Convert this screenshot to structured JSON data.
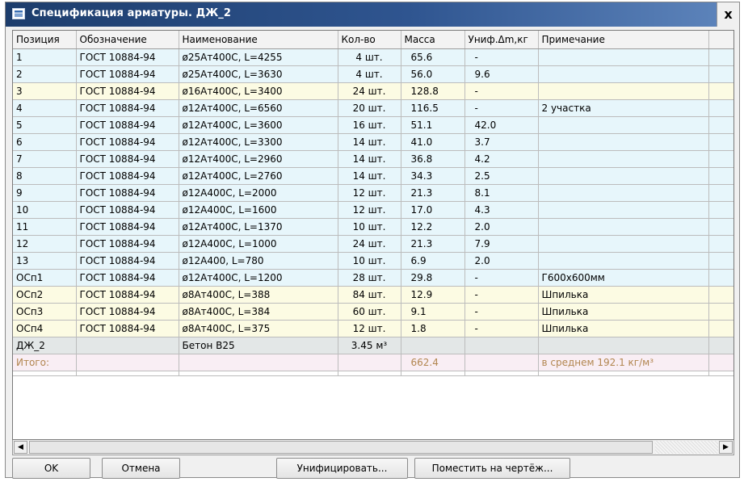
{
  "window": {
    "title": "Спецификация арматуры. ДЖ_2",
    "close_label": "x"
  },
  "table": {
    "columns": [
      "Позиция",
      "Обозначение",
      "Наименование",
      "Кол-во",
      "Масса",
      "Униф.Δm,кг",
      "Примечание"
    ],
    "rows": [
      {
        "pos": "1",
        "doc": "ГОСТ 10884-94",
        "name": "ø25Aт400C, L=4255",
        "qty": "4 шт.",
        "mass": "65.6",
        "unif": "-",
        "note": "",
        "color": "blue"
      },
      {
        "pos": "2",
        "doc": "ГОСТ 10884-94",
        "name": "ø25Aт400C, L=3630",
        "qty": "4 шт.",
        "mass": "56.0",
        "unif": "9.6",
        "note": "",
        "color": "blue"
      },
      {
        "pos": "3",
        "doc": "ГОСТ 10884-94",
        "name": "ø16Aт400C, L=3400",
        "qty": "24 шт.",
        "mass": "128.8",
        "unif": "-",
        "note": "",
        "color": "yellow"
      },
      {
        "pos": "4",
        "doc": "ГОСТ 10884-94",
        "name": "ø12Aт400C, L=6560",
        "qty": "20 шт.",
        "mass": "116.5",
        "unif": "-",
        "note": "2 участка",
        "color": "blue"
      },
      {
        "pos": "5",
        "doc": "ГОСТ 10884-94",
        "name": "ø12Aт400C, L=3600",
        "qty": "16 шт.",
        "mass": "51.1",
        "unif": "42.0",
        "note": "",
        "color": "blue"
      },
      {
        "pos": "6",
        "doc": "ГОСТ 10884-94",
        "name": "ø12Aт400C, L=3300",
        "qty": "14 шт.",
        "mass": "41.0",
        "unif": "3.7",
        "note": "",
        "color": "blue"
      },
      {
        "pos": "7",
        "doc": "ГОСТ 10884-94",
        "name": "ø12Aт400C, L=2960",
        "qty": "14 шт.",
        "mass": "36.8",
        "unif": "4.2",
        "note": "",
        "color": "blue"
      },
      {
        "pos": "8",
        "doc": "ГОСТ 10884-94",
        "name": "ø12Aт400C, L=2760",
        "qty": "14 шт.",
        "mass": "34.3",
        "unif": "2.5",
        "note": "",
        "color": "blue"
      },
      {
        "pos": "9",
        "doc": "ГОСТ 10884-94",
        "name": "ø12A400C, L=2000",
        "qty": "12 шт.",
        "mass": "21.3",
        "unif": "8.1",
        "note": "",
        "color": "blue"
      },
      {
        "pos": "10",
        "doc": "ГОСТ 10884-94",
        "name": "ø12A400C, L=1600",
        "qty": "12 шт.",
        "mass": "17.0",
        "unif": "4.3",
        "note": "",
        "color": "blue"
      },
      {
        "pos": "11",
        "doc": "ГОСТ 10884-94",
        "name": "ø12Aт400C, L=1370",
        "qty": "10 шт.",
        "mass": "12.2",
        "unif": "2.0",
        "note": "",
        "color": "blue"
      },
      {
        "pos": "12",
        "doc": "ГОСТ 10884-94",
        "name": "ø12A400C, L=1000",
        "qty": "24 шт.",
        "mass": "21.3",
        "unif": "7.9",
        "note": "",
        "color": "blue"
      },
      {
        "pos": "13",
        "doc": "ГОСТ 10884-94",
        "name": "ø12A400, L=780",
        "qty": "10 шт.",
        "mass": "6.9",
        "unif": "2.0",
        "note": "",
        "color": "blue"
      },
      {
        "pos": "ОСп1",
        "doc": "ГОСТ 10884-94",
        "name": "ø12Aт400C, L=1200",
        "qty": "28 шт.",
        "mass": "29.8",
        "unif": "-",
        "note": "Г600x600мм",
        "color": "blue"
      },
      {
        "pos": "ОСп2",
        "doc": "ГОСТ 10884-94",
        "name": "ø8Aт400C, L=388",
        "qty": "84 шт.",
        "mass": "12.9",
        "unif": "-",
        "note": "Шпилька",
        "color": "yellow"
      },
      {
        "pos": "ОСп3",
        "doc": "ГОСТ 10884-94",
        "name": "ø8Aт400C, L=384",
        "qty": "60 шт.",
        "mass": "9.1",
        "unif": "-",
        "note": "Шпилька",
        "color": "yellow"
      },
      {
        "pos": "ОСп4",
        "doc": "ГОСТ 10884-94",
        "name": "ø8Aт400C, L=375",
        "qty": "12 шт.",
        "mass": "1.8",
        "unif": "-",
        "note": "Шпилька",
        "color": "yellow"
      },
      {
        "pos": "ДЖ_2",
        "doc": "",
        "name": "Бетон B25",
        "qty": "3.45 м³",
        "mass": "",
        "unif": "",
        "note": "",
        "color": "gray"
      },
      {
        "pos": "Итого:",
        "doc": "",
        "name": "",
        "qty": "",
        "mass": "662.4",
        "unif": "",
        "note": "в среднем 192.1 кг/м³",
        "color": "pink"
      }
    ]
  },
  "scrollbar": {
    "left_arrow": "◀",
    "right_arrow": "▶"
  },
  "buttons": {
    "ok": "OK",
    "cancel": "Отмена",
    "unify": "Унифицировать...",
    "place": "Поместить на чертёж..."
  },
  "colors": {
    "title_bar": "#2f5590",
    "row_blue": "#e7f6fb",
    "row_yellow": "#fcfbe3",
    "row_gray": "#e3e7e7",
    "row_pink": "#f9eef4"
  }
}
